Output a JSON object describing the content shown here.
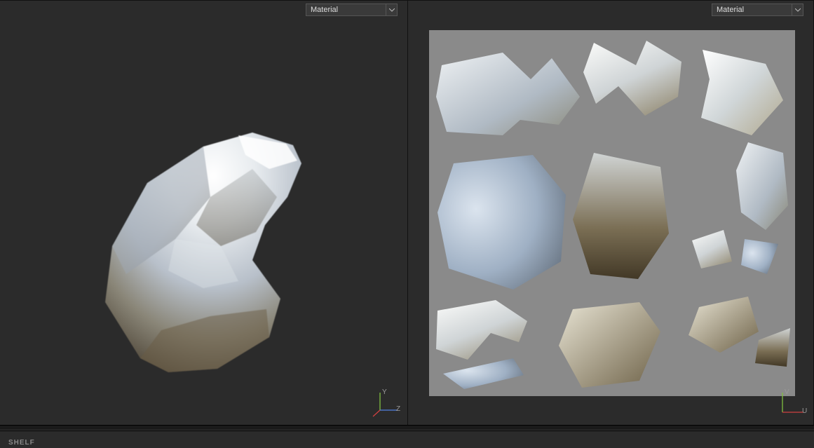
{
  "viewports": {
    "left": {
      "shading_mode": "Material",
      "axes": {
        "vertical": "Y",
        "horizontal": "Z"
      }
    },
    "right": {
      "shading_mode": "Material",
      "axes": {
        "vertical": "V",
        "horizontal": "U"
      }
    }
  },
  "shelf": {
    "label": "SHELF"
  },
  "colors": {
    "viewport_bg": "#2b2b2b",
    "uv_bg": "#8a8a8a",
    "axis_y": "#7fbf3f",
    "axis_x": "#d04040",
    "axis_z": "#5080e0"
  }
}
